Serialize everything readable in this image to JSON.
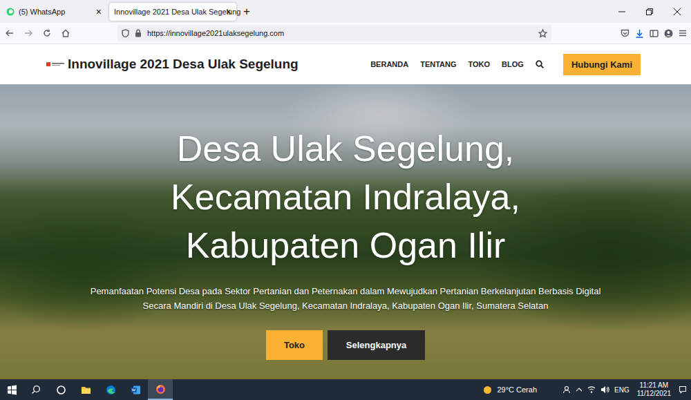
{
  "browser": {
    "tabs": [
      {
        "label": "(5) WhatsApp",
        "close": "×",
        "selected": false
      },
      {
        "label": "Innovillage 2021 Desa Ulak Segelung",
        "close": "×",
        "selected": true
      }
    ],
    "new_tab": "+",
    "url": "https://innovillage2021ulaksegelung.com"
  },
  "site": {
    "title": "Innovillage 2021 Desa Ulak Segelung",
    "nav": [
      "BERANDA",
      "TENTANG",
      "TOKO",
      "BLOG"
    ],
    "contact_button": "Hubungi Kami",
    "hero": {
      "headline": [
        "Desa Ulak Segelung,",
        "Kecamatan Indralaya,",
        "Kabupaten Ogan Ilir"
      ],
      "subtitle": [
        "Pemanfaatan Potensi Desa pada Sektor Pertanian dan Peternakan dalam Mewujudkan Pertanian Berkelanjutan Berbasis Digital",
        "Secara Mandiri di Desa Ulak Segelung, Kecamatan Indralaya, Kabupaten Ogan Ilir, Sumatera Selatan"
      ],
      "buttons": [
        {
          "label": "Toko",
          "kind": "primary"
        },
        {
          "label": "Selengkapnya",
          "kind": "dark"
        }
      ]
    }
  },
  "taskbar": {
    "apps": [
      {
        "kind": "start",
        "selected": false
      },
      {
        "kind": "search",
        "selected": false
      },
      {
        "kind": "taskview",
        "selected": false
      },
      {
        "kind": "explorer",
        "selected": false
      },
      {
        "kind": "edge",
        "selected": false
      },
      {
        "kind": "word",
        "selected": false
      },
      {
        "kind": "firefox",
        "selected": true
      }
    ],
    "weather": "29°C Cerah",
    "language": "ENG",
    "time": "11:21 AM",
    "date": "11/12/2021"
  }
}
